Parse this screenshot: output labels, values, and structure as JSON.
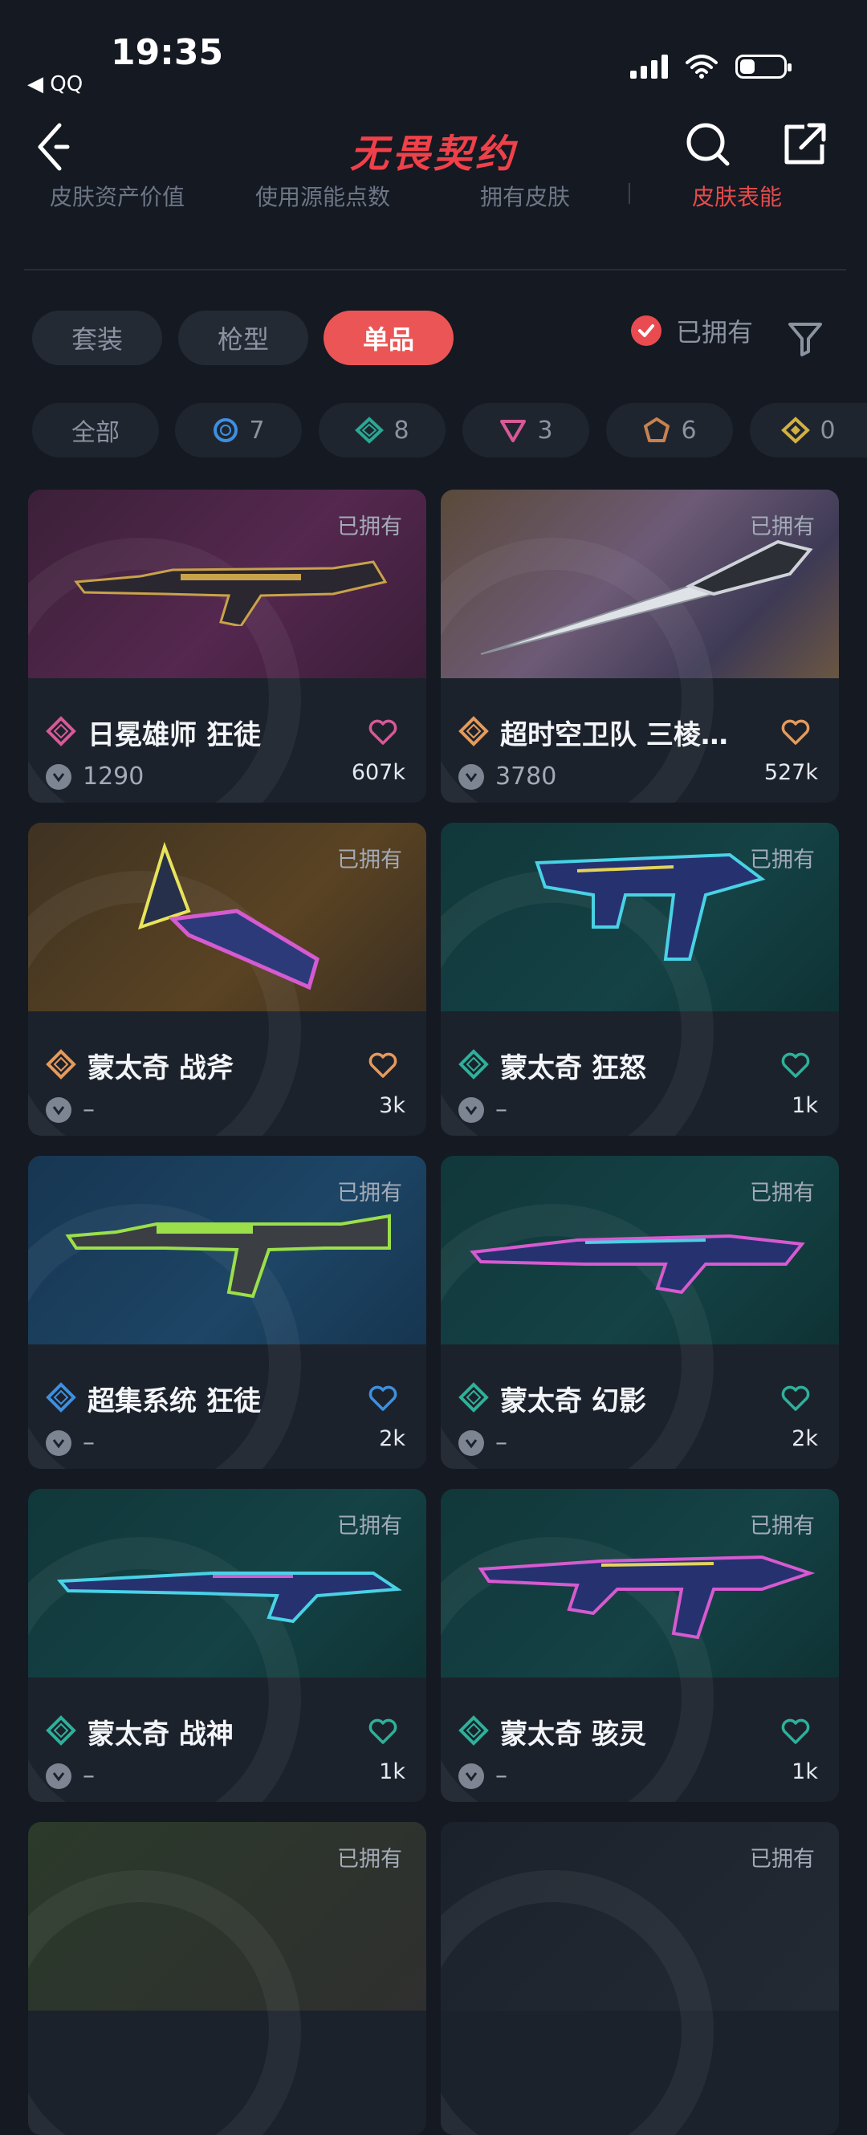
{
  "status": {
    "time": "19:35",
    "back_app": "◀ QQ"
  },
  "header": {
    "title": "无畏契约"
  },
  "top_tabs": [
    {
      "label": "皮肤资产价值"
    },
    {
      "label": "使用源能点数"
    },
    {
      "label": "拥有皮肤"
    },
    {
      "label": "皮肤表能"
    }
  ],
  "filters": {
    "types": [
      {
        "label": "套装"
      },
      {
        "label": "枪型"
      },
      {
        "label": "单品"
      }
    ],
    "owned_label": "已拥有"
  },
  "rarity": [
    {
      "label": "全部"
    },
    {
      "label": "7",
      "color": "#3f8fe0"
    },
    {
      "label": "8",
      "color": "#2aa894"
    },
    {
      "label": "3",
      "color": "#d65a97"
    },
    {
      "label": "6",
      "color": "#c9824f"
    },
    {
      "label": "0",
      "color": "#d3b042"
    }
  ],
  "cards": [
    {
      "title": "日冕雄师 狂徒",
      "price": "1290",
      "likes": "607k",
      "owned": "已拥有",
      "tier": "#d65a97",
      "like_color": "#d65a97"
    },
    {
      "title": "超时空卫队 三棱…",
      "price": "3780",
      "likes": "527k",
      "owned": "已拥有",
      "tier": "#e59a5b",
      "like_color": "#e59a5b"
    },
    {
      "title": "蒙太奇 战斧",
      "price": "–",
      "likes": "3k",
      "owned": "已拥有",
      "tier": "#e59a5b",
      "like_color": "#e59a5b"
    },
    {
      "title": "蒙太奇 狂怒",
      "price": "–",
      "likes": "1k",
      "owned": "已拥有",
      "tier": "#2fb09a",
      "like_color": "#2fb09a"
    },
    {
      "title": "超集系统 狂徒",
      "price": "–",
      "likes": "2k",
      "owned": "已拥有",
      "tier": "#3f8fe0",
      "like_color": "#3f8fe0"
    },
    {
      "title": "蒙太奇 幻影",
      "price": "–",
      "likes": "2k",
      "owned": "已拥有",
      "tier": "#2fb09a",
      "like_color": "#2fb09a"
    },
    {
      "title": "蒙太奇 战神",
      "price": "–",
      "likes": "1k",
      "owned": "已拥有",
      "tier": "#2fb09a",
      "like_color": "#2fb09a"
    },
    {
      "title": "蒙太奇 骇灵",
      "price": "–",
      "likes": "1k",
      "owned": "已拥有",
      "tier": "#2fb09a",
      "like_color": "#2fb09a"
    },
    {
      "title": "",
      "price": "",
      "likes": "",
      "owned": "已拥有",
      "tier": "",
      "like_color": ""
    },
    {
      "title": "",
      "price": "",
      "likes": "",
      "owned": "已拥有",
      "tier": "",
      "like_color": ""
    }
  ]
}
